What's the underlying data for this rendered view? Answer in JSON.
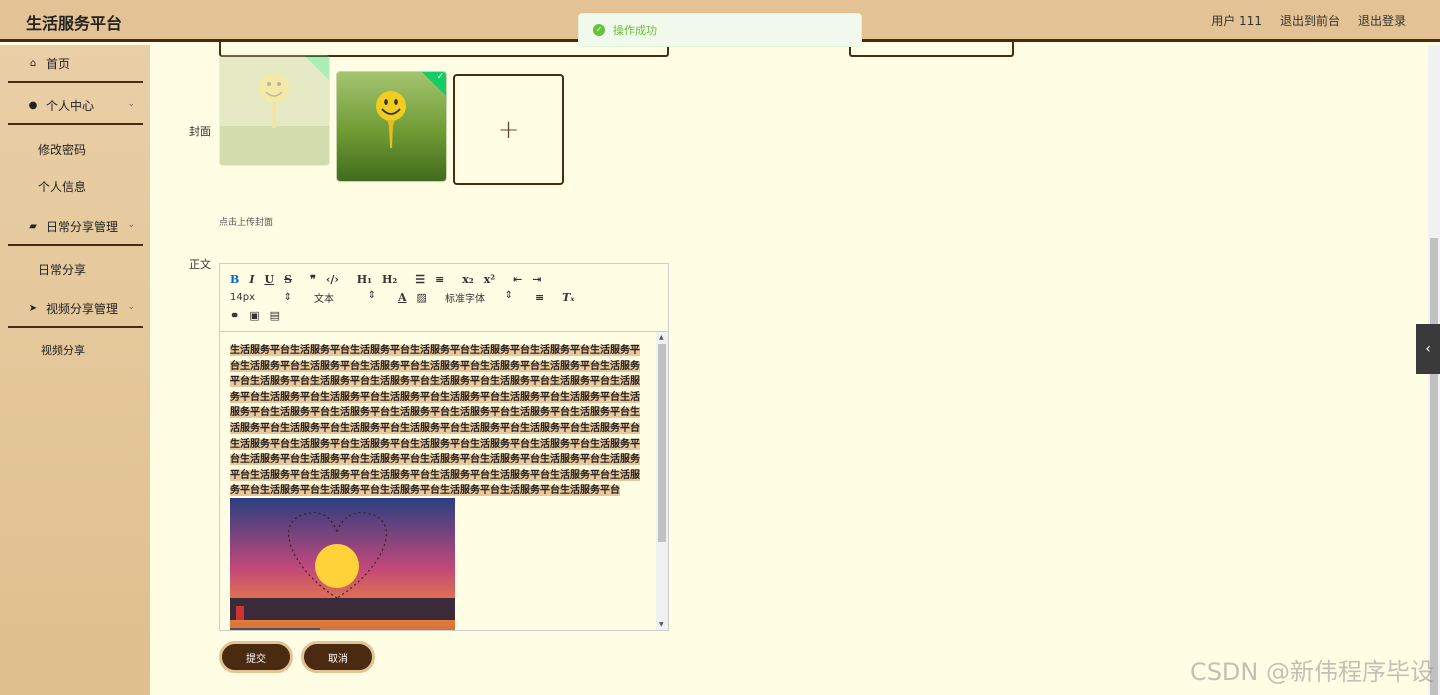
{
  "app": {
    "title": "生活服务平台"
  },
  "topnav": {
    "user": "用户 111",
    "back_front": "退出到前台",
    "logout": "退出登录"
  },
  "toast": {
    "message": "操作成功"
  },
  "sidebar": {
    "items": [
      {
        "label": "首页",
        "icon": "home-icon"
      },
      {
        "label": "个人中心",
        "icon": "user-icon"
      },
      {
        "label": "修改密码"
      },
      {
        "label": "个人信息"
      },
      {
        "label": "日常分享管理",
        "icon": "share-icon"
      },
      {
        "label": "日常分享"
      },
      {
        "label": "视频分享管理",
        "icon": "send-icon"
      },
      {
        "label": "视频分享"
      }
    ]
  },
  "form": {
    "cover_label": "封面",
    "upload_hint": "点击上传封面",
    "body_label": "正文",
    "submit": "提交",
    "cancel": "取消"
  },
  "editor": {
    "font_size": "14px",
    "text_style": "文本",
    "font_family": "标准字体",
    "content_text": "生活服务平台生活服务平台生活服务平台生活服务平台生活服务平台生活服务平台生活服务平台生活服务平台生活服务平台生活服务平台生活服务平台生活服务平台生活服务平台生活服务平台生活服务平台生活服务平台生活服务平台生活服务平台生活服务平台生活服务平台生活服务平台生活服务平台生活服务平台生活服务平台生活服务平台生活服务平台生活服务平台生活服务平台生活服务平台生活服务平台生活服务平台生活服务平台生活服务平台生活服务平台生活服务平台生活服务平台生活服务平台生活服务平台生活服务平台生活服务平台生活服务平台生活服务平台生活服务平台生活服务平台生活服务平台生活服务平台生活服务平台生活服务平台生活服务平台生活服务平台生活服务平台生活服务平台生活服务平台生活服务平台生活服务平台生活服务平台生活服务平台生活服务平台生活服务平台生活服务平台生活服务平台生活服务平台生活服务平台生活服务平台生活服务平台生活服务平台生活服务平台生活服务平台"
  },
  "watermark": "CSDN @新伟程序毕设",
  "colors": {
    "accent": "#4a2a10",
    "topbar": "#e3c395",
    "background": "#fffde3",
    "success": "#67c23a"
  }
}
